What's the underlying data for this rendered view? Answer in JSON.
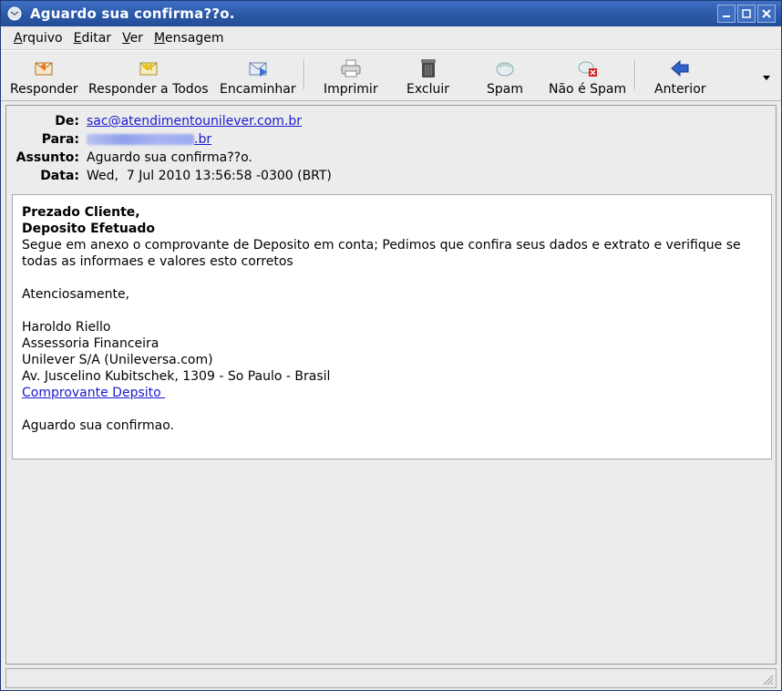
{
  "window": {
    "title": "Aguardo sua confirma??o."
  },
  "menubar": {
    "items": [
      {
        "underline": "A",
        "rest": "rquivo"
      },
      {
        "underline": "E",
        "rest": "ditar"
      },
      {
        "underline": "V",
        "rest": "er"
      },
      {
        "underline": "M",
        "rest": "ensagem"
      }
    ]
  },
  "toolbar": {
    "reply": "Responder",
    "reply_all": "Responder a Todos",
    "forward": "Encaminhar",
    "print": "Imprimir",
    "delete": "Excluir",
    "spam": "Spam",
    "not_spam": "Não é Spam",
    "previous": "Anterior"
  },
  "headers": {
    "from_label": "De:",
    "from_value": "sac@atendimentounilever.com.br",
    "to_label": "Para:",
    "to_value_suffix": ".br",
    "subject_label": "Assunto:",
    "subject_value": "Aguardo sua confirma??o.",
    "date_label": "Data:",
    "date_value": "Wed,  7 Jul 2010 13:56:58 -0300 (BRT)"
  },
  "message": {
    "greeting": "Prezado Cliente,",
    "heading": "Deposito Efetuado",
    "para1_line1": "Segue em anexo o comprovante de Deposito em conta; Pedimos que confira seus dados e extrato e verifique se",
    "para1_line2": "todas as informaes e valores esto corretos",
    "closing": "Atenciosamente,",
    "sig_name": "Haroldo Riello",
    "sig_title": "Assessoria Financeira",
    "sig_company": "Unilever S/A (Unileversa.com)",
    "sig_address": "Av. Juscelino Kubitschek, 1309 - So Paulo - Brasil",
    "sig_link": "Comprovante Depsito ",
    "final": "Aguardo sua confirmao."
  },
  "colors": {
    "titlebar": "#2b59a8",
    "link": "#1a1ad0",
    "window_bg": "#ececec"
  }
}
